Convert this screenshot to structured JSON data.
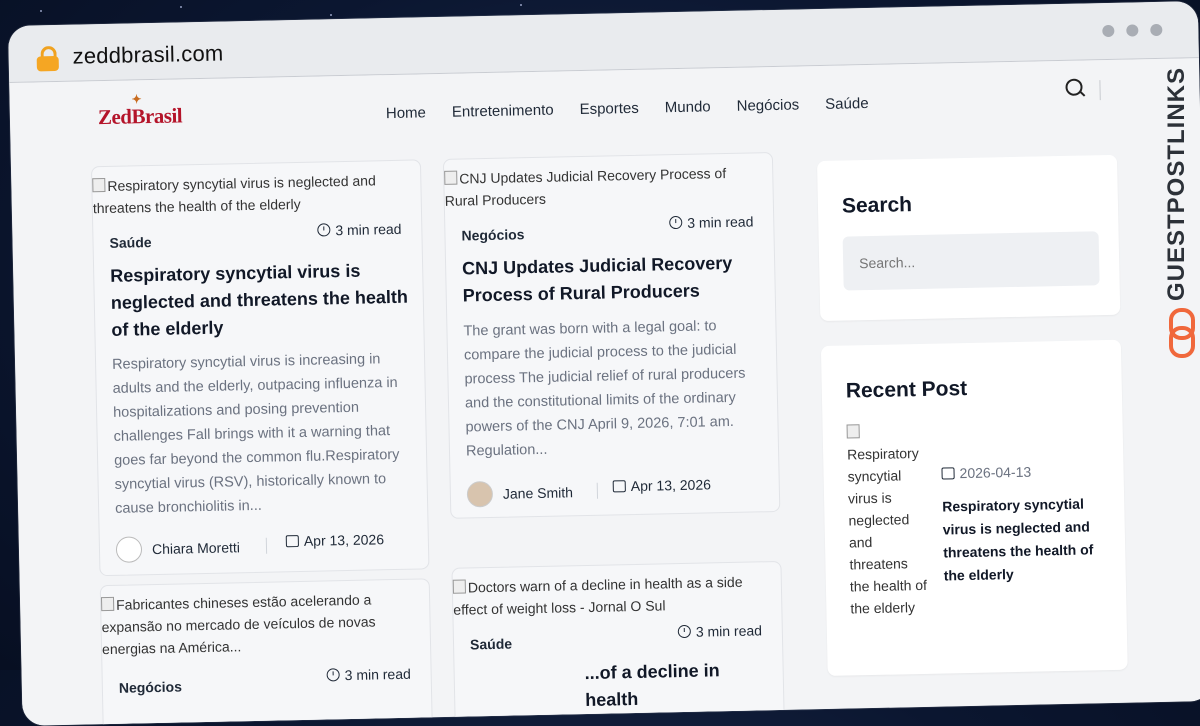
{
  "browser": {
    "url": "zeddbrasil.com"
  },
  "site": {
    "logo_text": "ZedBrasil"
  },
  "nav": {
    "items": [
      "Home",
      "Entretenimento",
      "Esportes",
      "Mundo",
      "Negócios",
      "Saúde"
    ]
  },
  "posts": [
    {
      "img_alt": "Respiratory syncytial virus is neglected and threatens the health of the elderly",
      "category": "Saúde",
      "read_time": "3 min read",
      "title": "Respiratory syncytial virus is neglected and threatens the health of the elderly",
      "excerpt": "Respiratory syncytial virus is increasing in adults and the elderly, outpacing influenza in hospitalizations and posing prevention challenges Fall brings with it a warning that goes far beyond the common flu.Respiratory syncytial virus (RSV), historically known to cause bronchiolitis in...",
      "author": "Chiara Moretti",
      "date": "Apr 13, 2026"
    },
    {
      "img_alt": "CNJ Updates Judicial Recovery Process of Rural Producers",
      "category": "Negócios",
      "read_time": "3 min read",
      "title": "CNJ Updates Judicial Recovery Process of Rural Producers",
      "excerpt": "The grant was born with a legal goal: to compare the judicial process to the judicial process The judicial relief of rural producers and the constitutional limits of the ordinary powers of the CNJ April 9, 2026, 7:01 am. Regulation...",
      "author": "Jane Smith",
      "date": "Apr 13, 2026"
    },
    {
      "img_alt": "Fabricantes chineses estão acelerando a expansão no mercado de veículos de novas energias na América...",
      "category": "Negócios",
      "read_time": "3 min read"
    },
    {
      "img_alt": "Doctors warn of a decline in health as a side effect of weight loss - Jornal O Sul",
      "category": "Saúde",
      "read_time": "3 min read",
      "title_fragment": "...of a decline in health"
    }
  ],
  "sidebar": {
    "search_title": "Search",
    "search_placeholder": "Search...",
    "recent_title": "Recent Post",
    "recent": {
      "img_alt": "Respiratory syncytial virus is neglected and threatens the health of the elderly",
      "date": "2026-04-13",
      "title": "Respiratory syncytial virus is neglected and threatens the health of the elderly"
    }
  },
  "watermark": {
    "text": "GUESTPOSTLINKS"
  },
  "colors": {
    "logo": "#b4142a",
    "lock": "#f5a623",
    "watermark_accent": "#f0683c",
    "page_bg": "#f3f4f6"
  }
}
